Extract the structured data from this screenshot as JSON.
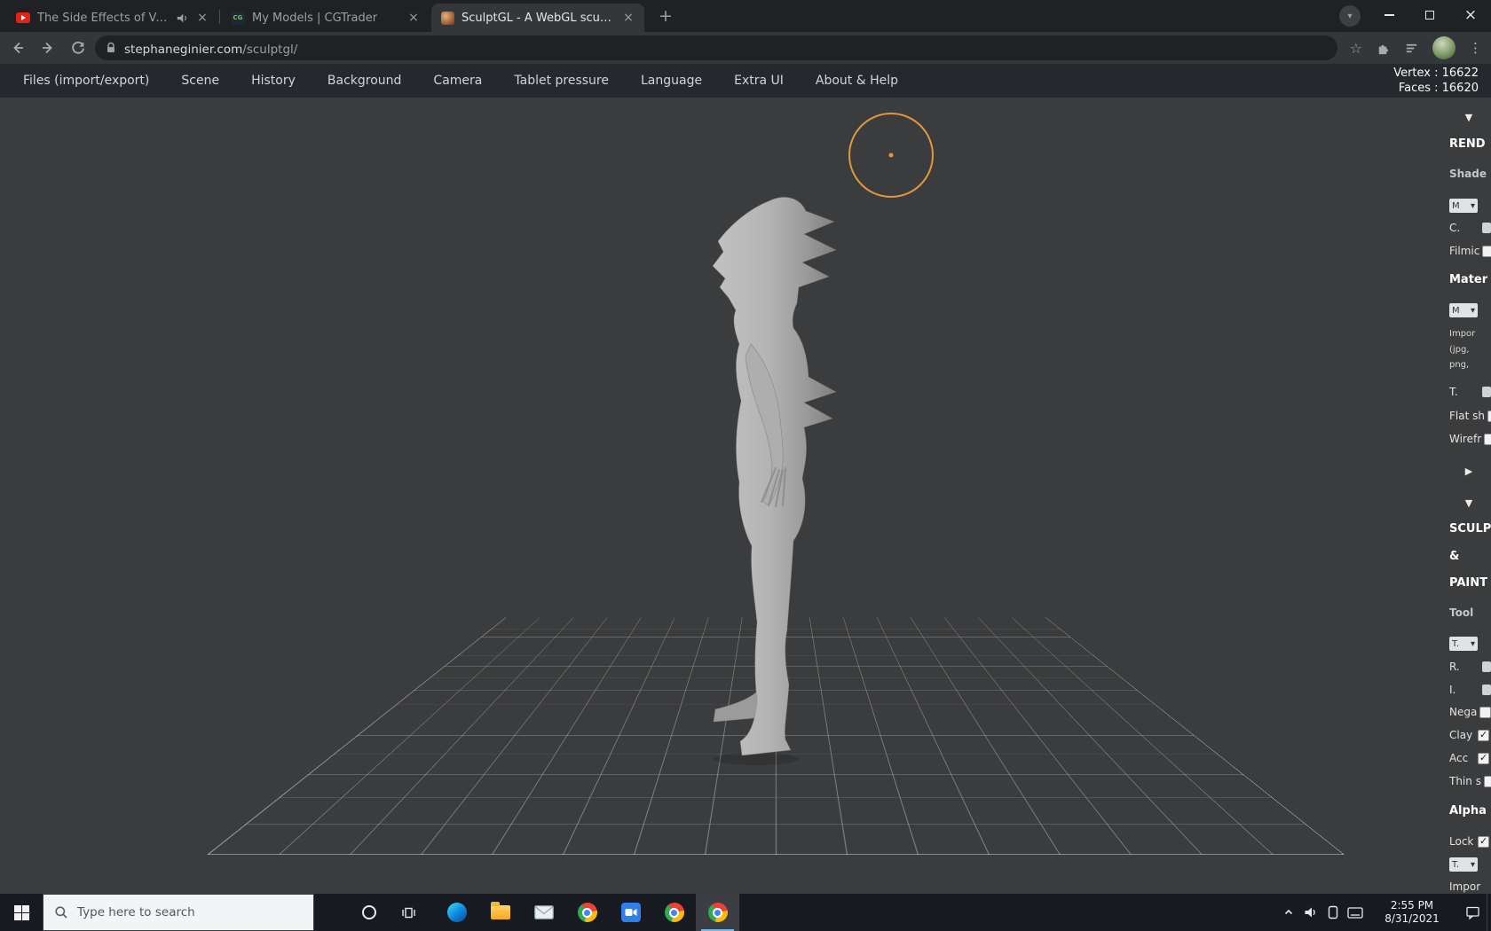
{
  "icons": {
    "close": "×",
    "new_tab": "+",
    "kebab": "⋮",
    "star": "☆",
    "select_chevron": "▾",
    "tab_search_chevron": "▾"
  },
  "browser": {
    "tabs": [
      {
        "title": "The Side Effects of Vaccines",
        "favicon": "youtube",
        "audio": true
      },
      {
        "title": "My Models | CGTrader",
        "favicon": "cgtrader"
      },
      {
        "title": "SculptGL - A WebGL sculpting ap",
        "favicon": "sculptgl",
        "active": true
      }
    ],
    "cg_favicon_text": "CG",
    "url": {
      "domain": "stephaneginier.com",
      "path": "/sculptgl/"
    }
  },
  "menu": {
    "items": [
      "Files (import/export)",
      "Scene",
      "History",
      "Background",
      "Camera",
      "Tablet pressure",
      "Language",
      "Extra UI",
      "About & Help"
    ]
  },
  "stats": {
    "vertex": "Vertex : 16622",
    "faces": "Faces : 16620"
  },
  "panel": {
    "items": [
      {
        "label": "▼"
      },
      {
        "label": "REND"
      },
      {
        "label": "Shade"
      },
      {
        "label": "M"
      },
      {
        "label": "C."
      },
      {
        "label": "Filmic",
        "checked": false
      },
      {
        "label": "Mater"
      },
      {
        "label": "M"
      },
      {
        "label": "Impor"
      },
      {
        "label": "(jpg,"
      },
      {
        "label": "png,"
      },
      {
        "label": "T."
      },
      {
        "label": "Flat sh",
        "checked": false
      },
      {
        "label": "Wirefr",
        "checked": false
      },
      {
        "label": "▶"
      },
      {
        "label": "▼"
      },
      {
        "label": "SCULP"
      },
      {
        "label": "&"
      },
      {
        "label": "PAINT"
      },
      {
        "label": "Tool"
      },
      {
        "label": "T."
      },
      {
        "label": "R."
      },
      {
        "label": "I."
      },
      {
        "label": "Nega",
        "checked": false
      },
      {
        "label": "Clay",
        "checked": true
      },
      {
        "label": "Acc",
        "checked": true
      },
      {
        "label": "Thin s",
        "checked": false
      },
      {
        "label": "Alpha"
      },
      {
        "label": "Lock",
        "checked": true
      },
      {
        "label": "T."
      },
      {
        "label": "Impor"
      }
    ]
  },
  "taskbar": {
    "search_placeholder": "Type here to search",
    "clock": {
      "time": "2:55 PM",
      "date": "8/31/2021"
    }
  }
}
